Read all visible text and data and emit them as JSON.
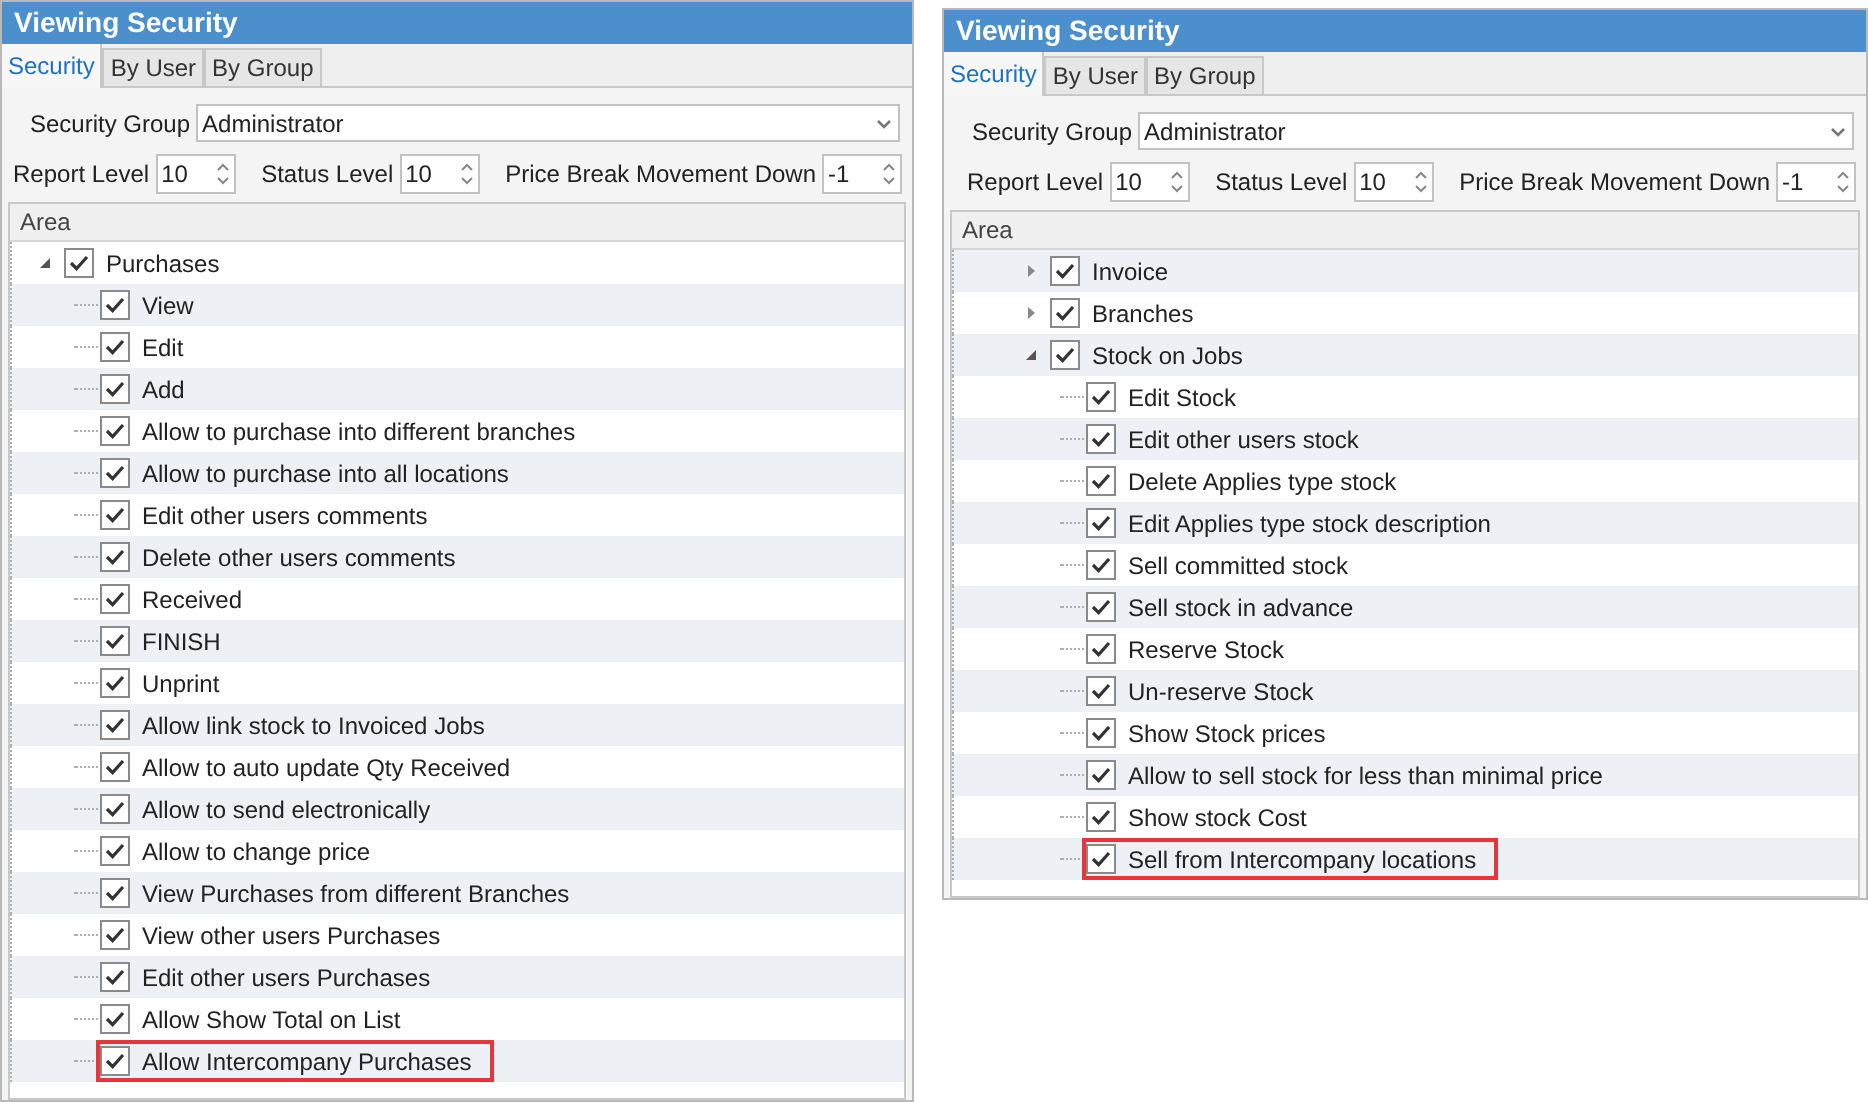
{
  "panels": [
    {
      "title": "Viewing Security",
      "tabs": [
        {
          "label": "Security",
          "selected": true
        },
        {
          "label": "By User",
          "selected": false
        },
        {
          "label": "By Group",
          "selected": false
        }
      ],
      "security_group": {
        "label": "Security Group",
        "value": "Administrator"
      },
      "levels": [
        {
          "label": "Report Level",
          "value": "10"
        },
        {
          "label": "Status Level",
          "value": "10"
        },
        {
          "label": "Price Break Movement Down",
          "value": "-1"
        }
      ],
      "column": "Area",
      "tree": [
        {
          "label": "Purchases",
          "checked": true,
          "expanded": true,
          "children": [
            {
              "label": "View",
              "checked": true
            },
            {
              "label": "Edit",
              "checked": true
            },
            {
              "label": "Add",
              "checked": true
            },
            {
              "label": "Allow to purchase into different branches",
              "checked": true
            },
            {
              "label": "Allow to purchase into all locations",
              "checked": true
            },
            {
              "label": "Edit other users comments",
              "checked": true
            },
            {
              "label": "Delete other users comments",
              "checked": true
            },
            {
              "label": "Received",
              "checked": true
            },
            {
              "label": "FINISH",
              "checked": true
            },
            {
              "label": "Unprint",
              "checked": true
            },
            {
              "label": "Allow link stock to Invoiced Jobs",
              "checked": true
            },
            {
              "label": "Allow to auto update Qty Received",
              "checked": true
            },
            {
              "label": "Allow to send electronically",
              "checked": true
            },
            {
              "label": "Allow to change price",
              "checked": true
            },
            {
              "label": "View Purchases from different Branches",
              "checked": true
            },
            {
              "label": "View other users Purchases",
              "checked": true
            },
            {
              "label": "Edit other users Purchases",
              "checked": true
            },
            {
              "label": "Allow Show Total on List",
              "checked": true
            },
            {
              "label": "Allow Intercompany Purchases",
              "checked": true,
              "highlighted": true
            }
          ]
        }
      ]
    },
    {
      "title": "Viewing Security",
      "tabs": [
        {
          "label": "Security",
          "selected": true
        },
        {
          "label": "By User",
          "selected": false
        },
        {
          "label": "By Group",
          "selected": false
        }
      ],
      "security_group": {
        "label": "Security Group",
        "value": "Administrator"
      },
      "levels": [
        {
          "label": "Report Level",
          "value": "10"
        },
        {
          "label": "Status Level",
          "value": "10"
        },
        {
          "label": "Price Break Movement Down",
          "value": "-1"
        }
      ],
      "column": "Area",
      "tree": [
        {
          "label": "Invoice",
          "checked": true,
          "expanded": false
        },
        {
          "label": "Branches",
          "checked": true,
          "expanded": false
        },
        {
          "label": "Stock on Jobs",
          "checked": true,
          "expanded": true,
          "children": [
            {
              "label": "Edit Stock",
              "checked": true
            },
            {
              "label": "Edit other users stock",
              "checked": true
            },
            {
              "label": "Delete Applies type stock",
              "checked": true
            },
            {
              "label": "Edit Applies type stock description",
              "checked": true
            },
            {
              "label": "Sell committed stock",
              "checked": true
            },
            {
              "label": "Sell stock in advance",
              "checked": true
            },
            {
              "label": "Reserve Stock",
              "checked": true
            },
            {
              "label": "Un-reserve Stock",
              "checked": true
            },
            {
              "label": "Show Stock prices",
              "checked": true
            },
            {
              "label": "Allow to sell stock for less than minimal price",
              "checked": true
            },
            {
              "label": "Show stock Cost",
              "checked": true
            },
            {
              "label": "Sell from Intercompany locations",
              "checked": true,
              "highlighted": true
            }
          ]
        }
      ]
    }
  ]
}
